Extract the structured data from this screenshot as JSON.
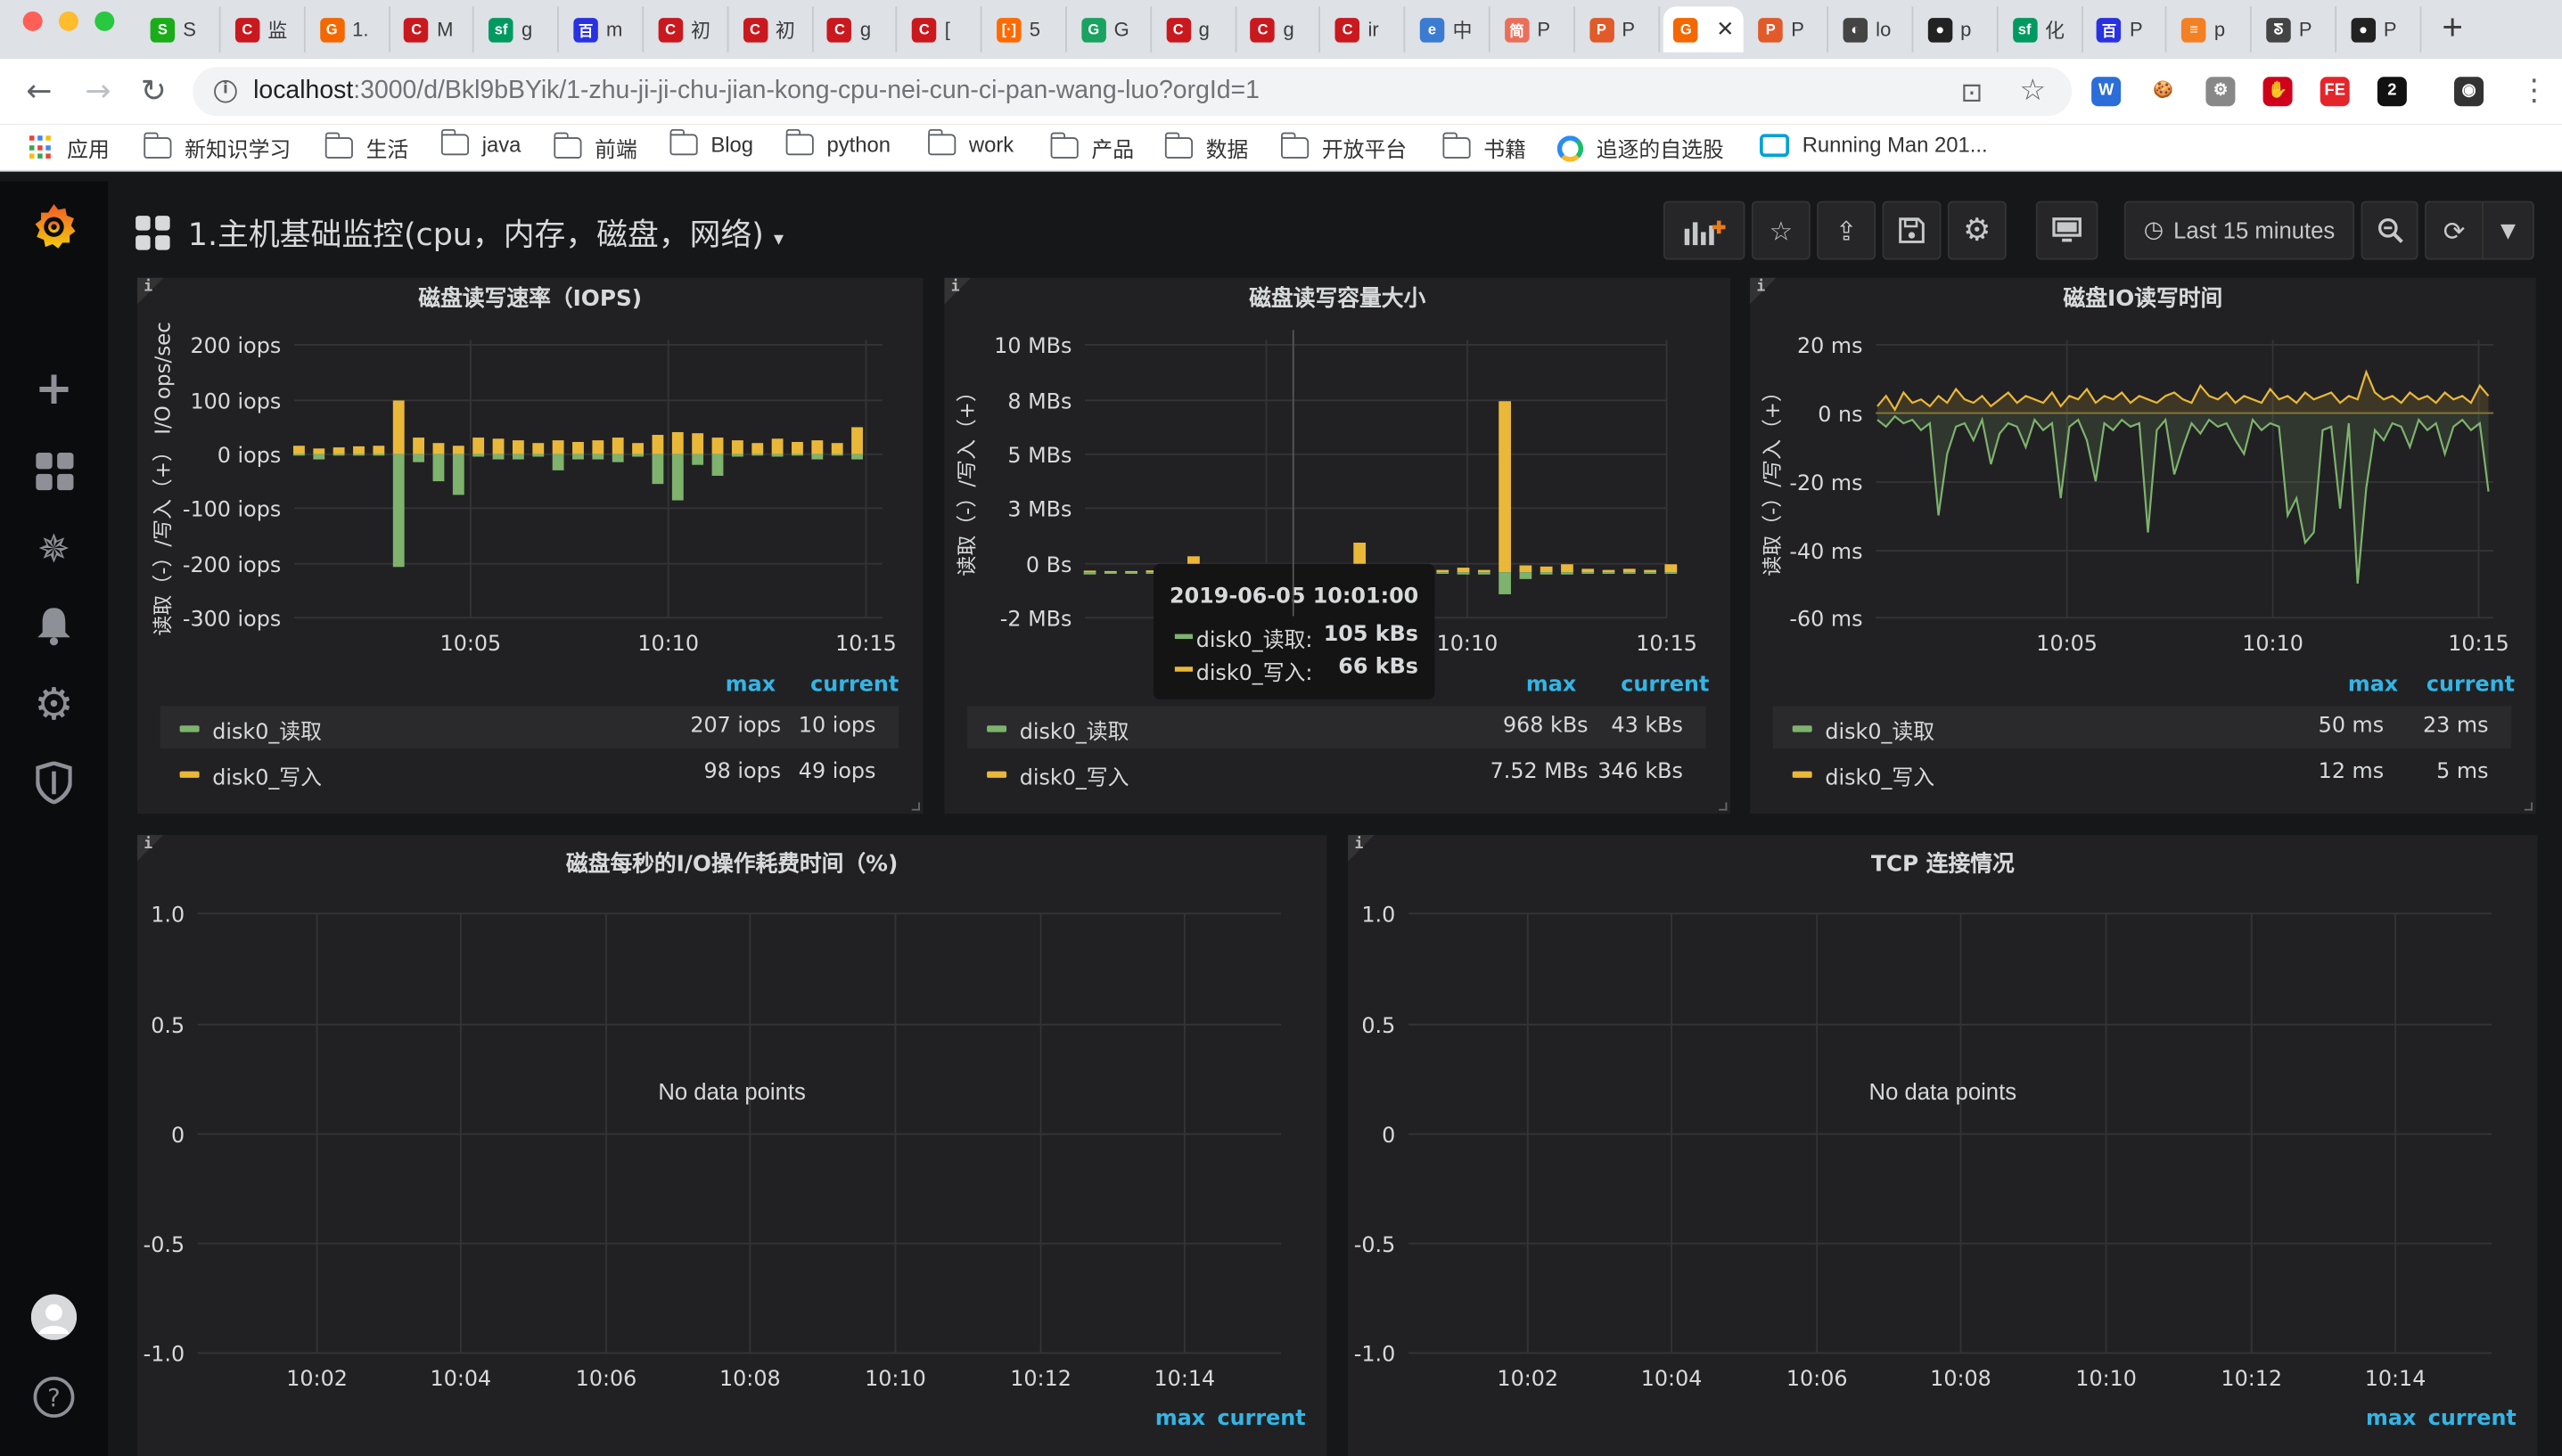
{
  "browser": {
    "tabs": [
      {
        "icon": "S",
        "color": "#1aad19",
        "label": "S"
      },
      {
        "icon": "C",
        "color": "#c9191e",
        "label": "监"
      },
      {
        "icon": "G",
        "color": "#f46800",
        "label": "1."
      },
      {
        "icon": "C",
        "color": "#c9191e",
        "label": "M"
      },
      {
        "icon": "sf",
        "color": "#009a61",
        "label": "g"
      },
      {
        "icon": "百",
        "color": "#2932e1",
        "label": "m"
      },
      {
        "icon": "C",
        "color": "#c9191e",
        "label": "初"
      },
      {
        "icon": "C",
        "color": "#c9191e",
        "label": "初"
      },
      {
        "icon": "C",
        "color": "#c9191e",
        "label": "g"
      },
      {
        "icon": "C",
        "color": "#c9191e",
        "label": "["
      },
      {
        "icon": "[·]",
        "color": "#ff6a00",
        "label": "5"
      },
      {
        "icon": "G",
        "color": "#1aa260",
        "label": "G"
      },
      {
        "icon": "C",
        "color": "#c9191e",
        "label": "g"
      },
      {
        "icon": "C",
        "color": "#c9191e",
        "label": "g"
      },
      {
        "icon": "C",
        "color": "#c9191e",
        "label": "ir"
      },
      {
        "icon": "e",
        "color": "#3b7bd1",
        "label": "中"
      },
      {
        "icon": "简",
        "color": "#ea6f5a",
        "label": "P"
      },
      {
        "icon": "P",
        "color": "#e05a2a",
        "label": "P"
      },
      {
        "icon": "G",
        "color": "#f46800",
        "label": ""
      },
      {
        "icon": "P",
        "color": "#e05a2a",
        "label": "P"
      },
      {
        "icon": "◐",
        "color": "#444444",
        "label": "lo"
      },
      {
        "icon": "●",
        "color": "#222222",
        "label": "p"
      },
      {
        "icon": "sf",
        "color": "#009a61",
        "label": "化"
      },
      {
        "icon": "百",
        "color": "#2932e1",
        "label": "P"
      },
      {
        "icon": "≡",
        "color": "#f48024",
        "label": "p"
      },
      {
        "icon": "ᘕ",
        "color": "#444444",
        "label": "P"
      },
      {
        "icon": "●",
        "color": "#222222",
        "label": "P"
      }
    ],
    "active_tab_index": 18,
    "url_host": "localhost",
    "url_rest": ":3000/d/Bkl9bBYik/1-zhu-ji-ji-chu-jian-kong-cpu-nei-cun-ci-pan-wang-luo?orgId=1",
    "extensions": [
      {
        "text": "W",
        "color": "#2b6dd9"
      },
      {
        "text": "🍪",
        "color": "#ffffff"
      },
      {
        "text": "⚙",
        "color": "#888888"
      },
      {
        "text": "✋",
        "color": "#d0021b"
      },
      {
        "text": "FE",
        "color": "#e4252b"
      },
      {
        "text": "2",
        "color": "#111111"
      },
      {
        "text": "◉",
        "color": "#333333"
      }
    ],
    "bookmarks": [
      {
        "label": "应用",
        "type": "apps"
      },
      {
        "label": "新知识学习",
        "type": "folder"
      },
      {
        "label": "生活",
        "type": "folder"
      },
      {
        "label": "java",
        "type": "folder"
      },
      {
        "label": "前端",
        "type": "folder"
      },
      {
        "label": "Blog",
        "type": "folder"
      },
      {
        "label": "python",
        "type": "folder"
      },
      {
        "label": "work",
        "type": "folder"
      },
      {
        "label": "产品",
        "type": "folder"
      },
      {
        "label": "数据",
        "type": "folder"
      },
      {
        "label": "开放平台",
        "type": "folder"
      },
      {
        "label": "书籍",
        "type": "folder"
      },
      {
        "label": "追逐的自选股",
        "type": "site"
      },
      {
        "label": "Running Man 201...",
        "type": "site"
      }
    ]
  },
  "dashboard": {
    "title": "1.主机基础监控(cpu，内存，磁盘，网络)",
    "time_range": "Last 15 minutes"
  },
  "colors": {
    "read": "#7eb26d",
    "write": "#eab839",
    "accent": "#33b5e5"
  },
  "legend_headers": {
    "max": "max",
    "current": "current"
  },
  "panels": [
    {
      "title": "磁盘读写速率（IOPS)",
      "ylabel": "读取（-）/写入（+） I/O ops/sec",
      "yticks": [
        "200 iops",
        "100 iops",
        "0 iops",
        "-100 iops",
        "-200 iops",
        "-300 iops"
      ],
      "xticks": [
        "10:05",
        "10:10",
        "10:15"
      ],
      "legend": [
        {
          "name": "disk0_读取",
          "max": "207 iops",
          "current": "10 iops"
        },
        {
          "name": "disk0_写入",
          "max": "98 iops",
          "current": "49 iops"
        }
      ]
    },
    {
      "title": "磁盘读写容量大小",
      "ylabel": "读取（-）/写入（+）",
      "yticks": [
        "10 MBs",
        "8 MBs",
        "5 MBs",
        "3 MBs",
        "0 Bs",
        "-2 MBs"
      ],
      "xticks": [
        "10:05",
        "10:10",
        "10:15"
      ],
      "legend": [
        {
          "name": "disk0_读取",
          "max": "968 kBs",
          "current": "43 kBs"
        },
        {
          "name": "disk0_写入",
          "max": "7.52 MBs",
          "current": "346 kBs"
        }
      ],
      "tooltip": {
        "time": "2019-06-05 10:01:00",
        "rows": [
          {
            "name": "disk0_读取:",
            "value": "105 kBs"
          },
          {
            "name": "disk0_写入:",
            "value": "66 kBs"
          }
        ]
      }
    },
    {
      "title": "磁盘IO读写时间",
      "ylabel": "读取（-）/写入（+）",
      "yticks": [
        "20 ms",
        "0 ns",
        "-20 ms",
        "-40 ms",
        "-60 ms"
      ],
      "xticks": [
        "10:05",
        "10:10",
        "10:15"
      ],
      "legend": [
        {
          "name": "disk0_读取",
          "max": "50 ms",
          "current": "23 ms"
        },
        {
          "name": "disk0_写入",
          "max": "12 ms",
          "current": "5 ms"
        }
      ]
    },
    {
      "title": "磁盘每秒的I/O操作耗费时间（%)",
      "yticks": [
        "1.0",
        "0.5",
        "0",
        "-0.5",
        "-1.0"
      ],
      "xticks": [
        "10:02",
        "10:04",
        "10:06",
        "10:08",
        "10:10",
        "10:12",
        "10:14"
      ],
      "empty_text": "No data points"
    },
    {
      "title": "TCP 连接情况",
      "yticks": [
        "1.0",
        "0.5",
        "0",
        "-0.5",
        "-1.0"
      ],
      "xticks": [
        "10:02",
        "10:04",
        "10:06",
        "10:08",
        "10:10",
        "10:12",
        "10:14"
      ],
      "empty_text": "No data points"
    }
  ],
  "chart_data": [
    {
      "type": "bar",
      "title": "磁盘读写速率（IOPS)",
      "ylabel": "读取（-）/写入（+） I/O ops/sec",
      "ylim": [
        -300,
        200
      ],
      "x": [
        "10:01",
        "10:01:30",
        "10:02",
        "10:02:30",
        "10:03",
        "10:03:30",
        "10:04",
        "10:04:30",
        "10:05",
        "10:05:30",
        "10:06",
        "10:06:30",
        "10:07",
        "10:07:30",
        "10:08",
        "10:08:30",
        "10:09",
        "10:09:30",
        "10:10",
        "10:10:30",
        "10:11",
        "10:11:30",
        "10:12",
        "10:12:30",
        "10:13",
        "10:13:30",
        "10:14",
        "10:14:30",
        "10:15"
      ],
      "series": [
        {
          "name": "disk0_写入",
          "values": [
            15,
            10,
            12,
            14,
            15,
            98,
            30,
            20,
            15,
            30,
            28,
            25,
            20,
            25,
            22,
            25,
            30,
            20,
            35,
            40,
            38,
            30,
            25,
            20,
            28,
            22,
            25,
            20,
            49
          ]
        },
        {
          "name": "disk0_读取",
          "values": [
            0,
            -10,
            0,
            0,
            0,
            -207,
            -15,
            -50,
            -75,
            -5,
            -10,
            -10,
            -5,
            -30,
            -10,
            -10,
            -15,
            -5,
            -55,
            -85,
            -20,
            -40,
            -5,
            0,
            -5,
            0,
            -10,
            0,
            -10
          ]
        }
      ]
    },
    {
      "type": "bar",
      "title": "磁盘读写容量大小",
      "ylabel": "读取（-）/写入（+）",
      "ylim": [
        -2,
        10
      ],
      "unit": "MBs",
      "x": [
        "10:01",
        "10:01:30",
        "10:02",
        "10:02:30",
        "10:03",
        "10:03:30",
        "10:04",
        "10:04:30",
        "10:05",
        "10:05:30",
        "10:06",
        "10:06:30",
        "10:07",
        "10:07:30",
        "10:08",
        "10:08:30",
        "10:09",
        "10:09:30",
        "10:10",
        "10:10:30",
        "10:11",
        "10:11:30",
        "10:12",
        "10:12:30",
        "10:13",
        "10:13:30",
        "10:14",
        "10:14:30",
        "10:15"
      ],
      "series": [
        {
          "name": "disk0_写入",
          "values": [
            0.07,
            0.05,
            0.05,
            0.08,
            0.1,
            0.7,
            0.3,
            0.15,
            0.2,
            0.15,
            0.3,
            0.25,
            0.2,
            1.3,
            0.2,
            0.1,
            0.15,
            0.1,
            0.2,
            0.1,
            7.52,
            0.3,
            0.25,
            0.35,
            0.15,
            0.1,
            0.15,
            0.1,
            0.35
          ]
        },
        {
          "name": "disk0_读取",
          "values": [
            -0.1,
            -0.05,
            -0.05,
            -0.05,
            -0.05,
            -0.1,
            -0.1,
            -0.05,
            -0.05,
            -0.05,
            -0.1,
            -0.1,
            -0.05,
            -0.2,
            -0.05,
            -0.05,
            -0.05,
            -0.05,
            -0.1,
            -0.1,
            -0.97,
            -0.3,
            -0.1,
            -0.1,
            -0.05,
            -0.05,
            -0.05,
            -0.05,
            -0.04
          ]
        }
      ]
    },
    {
      "type": "area",
      "title": "磁盘IO读写时间",
      "ylabel": "读取（-）/写入（+）",
      "ylim": [
        -60,
        20
      ],
      "unit": "ms",
      "series": [
        {
          "name": "disk0_写入",
          "values": [
            2,
            5,
            1,
            6,
            3,
            4,
            2,
            5,
            3,
            7,
            4,
            3,
            5,
            2,
            4,
            6,
            3,
            5,
            4,
            3,
            6,
            2,
            5,
            4,
            7,
            3,
            5,
            4,
            6,
            3,
            5,
            4,
            3,
            5,
            6,
            4,
            3,
            8,
            5,
            4,
            6,
            3,
            5,
            4,
            3,
            7,
            4,
            5,
            3,
            6,
            4,
            5,
            6,
            3,
            5,
            4,
            12,
            6,
            4,
            5,
            3,
            6,
            4,
            5,
            3,
            6,
            4,
            5,
            3,
            8,
            5
          ]
        },
        {
          "name": "disk0_读取",
          "values": [
            -2,
            -4,
            -1,
            -3,
            -2,
            -5,
            -3,
            -30,
            -12,
            -4,
            -3,
            -8,
            -2,
            -15,
            -6,
            -3,
            -4,
            -10,
            -2,
            -5,
            -3,
            -25,
            -4,
            -2,
            -8,
            -20,
            -3,
            -5,
            -2,
            -4,
            -3,
            -35,
            -5,
            -2,
            -18,
            -10,
            -3,
            -6,
            -2,
            -4,
            -3,
            -8,
            -12,
            -2,
            -5,
            -3,
            -4,
            -30,
            -25,
            -38,
            -35,
            -5,
            -4,
            -28,
            -3,
            -50,
            -22,
            -5,
            -8,
            -3,
            -4,
            -10,
            -2,
            -5,
            -3,
            -12,
            -4,
            -2,
            -5,
            -3,
            -23
          ]
        }
      ]
    }
  ]
}
